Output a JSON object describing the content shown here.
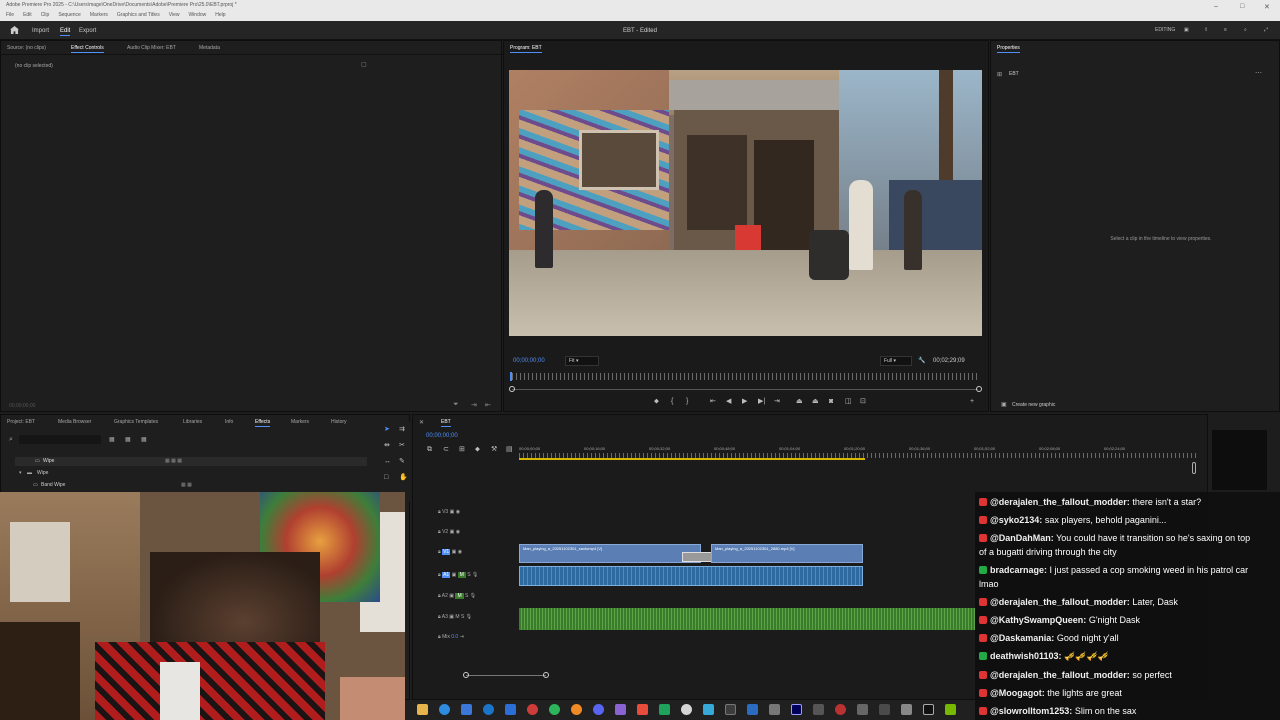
{
  "window": {
    "title": "Adobe Premiere Pro 2025 - C:\\Users\\mage\\OneDrive\\Documents\\Adobe\\Premiere Pro\\25.0\\EBT.prproj *"
  },
  "menu": [
    "File",
    "Edit",
    "Clip",
    "Sequence",
    "Markers",
    "Graphics and Titles",
    "View",
    "Window",
    "Help"
  ],
  "header": {
    "import": "Import",
    "edit": "Edit",
    "export": "Export",
    "doc_title": "EBT - Edited",
    "workspace": "EDITING"
  },
  "source_panel": {
    "tabs": [
      "Source: (no clips)",
      "Effect Controls",
      "Audio Clip Mixer: EBT",
      "Metadata"
    ],
    "no_clip": "(no clip selected)",
    "timecode": "00;00;00;00"
  },
  "program": {
    "tab": "Program: EBT",
    "timecode": "00;00;00;00",
    "fit": "Fit",
    "quality": "Full",
    "duration": "00;02;29;09"
  },
  "properties": {
    "tab": "Properties",
    "item": "EBT",
    "hint": "Select a clip in the timeline to view properties.",
    "create_graphic": "Create new graphic"
  },
  "effects_panel": {
    "tabs": [
      "Project: EBT",
      "Media Browser",
      "Graphics Templates",
      "Libraries",
      "Info",
      "Effects",
      "Markers",
      "History"
    ],
    "items": [
      "Wipe",
      "Wipe",
      "Band Wipe"
    ]
  },
  "timeline": {
    "tab": "EBT",
    "timecode": "00;00;00;00",
    "ruler": [
      "00;00;00;00",
      "00;00;16;00",
      "00;00;32;00",
      "00;00;48;00",
      "00;01;04;00",
      "00;01;20;00",
      "00;01;36;00",
      "00;01;52;00",
      "00;02;08;00",
      "00;02;24;00"
    ],
    "tracks": [
      "V3",
      "V2",
      "V1",
      "A1",
      "A2",
      "A3",
      "Mix"
    ],
    "clip1": "Man_playing_a_20251102301_saxtomp4 [V]",
    "clip2": "Man_playing_a_20251102301_2880.mp4 [V]",
    "mix_value": "0.0"
  },
  "chat": [
    {
      "user": "@derajalen_the_fallout_modder:",
      "text": "there isn't a star?",
      "badge": "red"
    },
    {
      "user": "@syko2134:",
      "text": "sax players, behold paganini...",
      "badge": "red"
    },
    {
      "user": "@DanDahMan:",
      "text": "You could have it transition so he's saxing on top",
      "badge": "red",
      "line2": "of a bugatti driving through the city"
    },
    {
      "user": "bradcarnage:",
      "text": "I just passed a cop smoking weed in his patrol car",
      "badge": "green",
      "line2": "lmao"
    },
    {
      "user": "@derajalen_the_fallout_modder:",
      "text": "Later, Dask",
      "badge": "red"
    },
    {
      "user": "@KathySwampQueen:",
      "text": "G'night Dask",
      "badge": "red"
    },
    {
      "user": "@Daskamania:",
      "text": "Good night y'all",
      "badge": "red"
    },
    {
      "user": "deathwish01103:",
      "text": "🎺🎺🎺🎺",
      "badge": "green"
    },
    {
      "user": "@derajalen_the_fallout_modder:",
      "text": "so perfect",
      "badge": "red"
    },
    {
      "user": "@Moogagot:",
      "text": "the lights are great",
      "badge": "red"
    },
    {
      "user": "@slowrolltom1253:",
      "text": "Slim on the sax",
      "badge": "red"
    }
  ],
  "colors": {
    "accent": "#4f8ff7",
    "video_clip": "#5b7fb4",
    "audio_clip": "#2e6aa0",
    "audio_green": "#3a7b2c"
  }
}
